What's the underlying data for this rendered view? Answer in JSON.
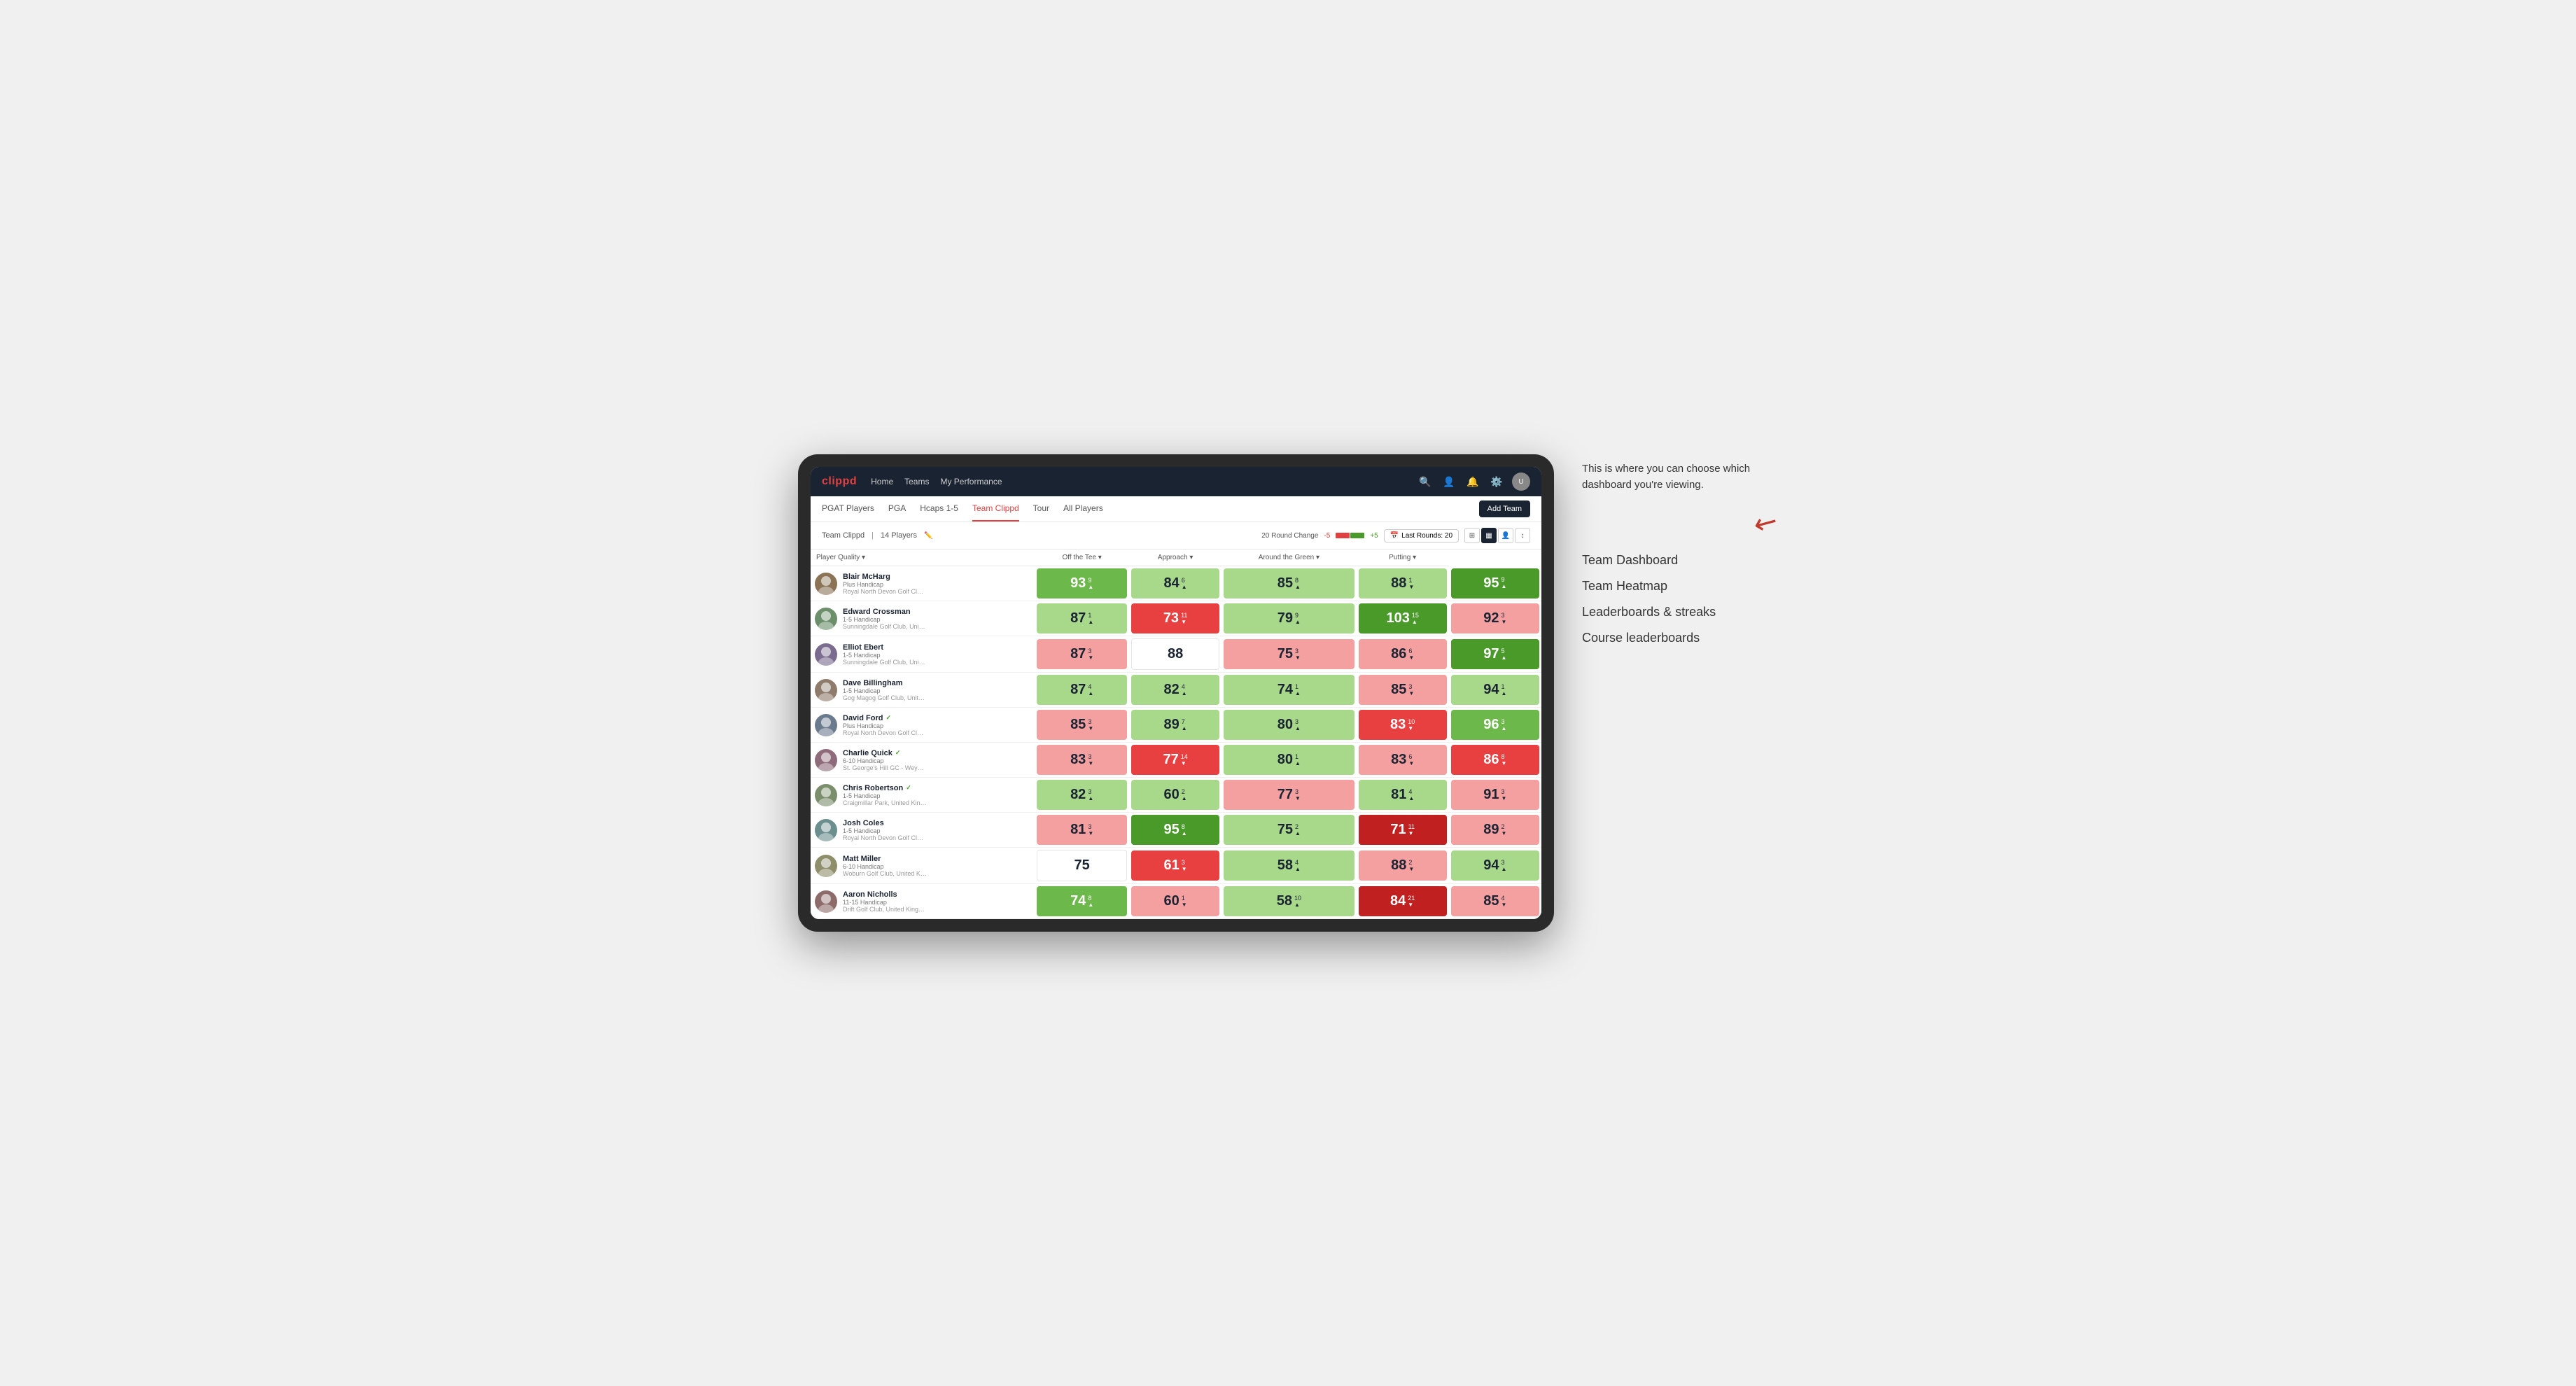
{
  "annotation": {
    "description": "This is where you can choose which dashboard you're viewing.",
    "options": [
      "Team Dashboard",
      "Team Heatmap",
      "Leaderboards & streaks",
      "Course leaderboards"
    ]
  },
  "nav": {
    "logo": "clippd",
    "items": [
      "Home",
      "Teams",
      "My Performance"
    ],
    "icons": [
      "search",
      "person",
      "bell",
      "settings",
      "avatar"
    ]
  },
  "sub_nav": {
    "items": [
      "PGAT Players",
      "PGA",
      "Hcaps 1-5",
      "Team Clippd",
      "Tour",
      "All Players"
    ],
    "active": "Team Clippd",
    "add_button": "Add Team"
  },
  "team_header": {
    "team_name": "Team Clippd",
    "player_count": "14 Players",
    "round_change_label": "20 Round Change",
    "change_neg": "-5",
    "change_pos": "+5",
    "last_rounds_label": "Last Rounds:",
    "last_rounds_value": "20"
  },
  "table": {
    "columns": [
      "Player Quality ▾",
      "Off the Tee ▾",
      "Approach ▾",
      "Around the Green ▾",
      "Putting ▾"
    ],
    "rows": [
      {
        "name": "Blair McHarg",
        "handicap": "Plus Handicap",
        "club": "Royal North Devon Golf Club, United Kingdom",
        "scores": [
          {
            "value": "93",
            "change": "9",
            "dir": "up",
            "color": "green-medium"
          },
          {
            "value": "84",
            "change": "6",
            "dir": "up",
            "color": "green-light"
          },
          {
            "value": "85",
            "change": "8",
            "dir": "up",
            "color": "green-light"
          },
          {
            "value": "88",
            "change": "1",
            "dir": "down",
            "color": "green-light"
          },
          {
            "value": "95",
            "change": "9",
            "dir": "up",
            "color": "green-dark"
          }
        ]
      },
      {
        "name": "Edward Crossman",
        "handicap": "1-5 Handicap",
        "club": "Sunningdale Golf Club, United Kingdom",
        "scores": [
          {
            "value": "87",
            "change": "1",
            "dir": "up",
            "color": "green-light"
          },
          {
            "value": "73",
            "change": "11",
            "dir": "down",
            "color": "red-medium"
          },
          {
            "value": "79",
            "change": "9",
            "dir": "up",
            "color": "green-light"
          },
          {
            "value": "103",
            "change": "15",
            "dir": "up",
            "color": "green-dark"
          },
          {
            "value": "92",
            "change": "3",
            "dir": "down",
            "color": "red-light"
          }
        ]
      },
      {
        "name": "Elliot Ebert",
        "handicap": "1-5 Handicap",
        "club": "Sunningdale Golf Club, United Kingdom",
        "scores": [
          {
            "value": "87",
            "change": "3",
            "dir": "down",
            "color": "red-light"
          },
          {
            "value": "88",
            "change": "",
            "dir": "",
            "color": "white-cell"
          },
          {
            "value": "75",
            "change": "3",
            "dir": "down",
            "color": "red-light"
          },
          {
            "value": "86",
            "change": "6",
            "dir": "down",
            "color": "red-light"
          },
          {
            "value": "97",
            "change": "5",
            "dir": "up",
            "color": "green-dark"
          }
        ]
      },
      {
        "name": "Dave Billingham",
        "handicap": "1-5 Handicap",
        "club": "Gog Magog Golf Club, United Kingdom",
        "scores": [
          {
            "value": "87",
            "change": "4",
            "dir": "up",
            "color": "green-light"
          },
          {
            "value": "82",
            "change": "4",
            "dir": "up",
            "color": "green-light"
          },
          {
            "value": "74",
            "change": "1",
            "dir": "up",
            "color": "green-light"
          },
          {
            "value": "85",
            "change": "3",
            "dir": "down",
            "color": "red-light"
          },
          {
            "value": "94",
            "change": "1",
            "dir": "up",
            "color": "green-light"
          }
        ]
      },
      {
        "name": "David Ford",
        "handicap": "Plus Handicap",
        "club": "Royal North Devon Golf Club, United Kingdom",
        "verified": true,
        "scores": [
          {
            "value": "85",
            "change": "3",
            "dir": "down",
            "color": "red-light"
          },
          {
            "value": "89",
            "change": "7",
            "dir": "up",
            "color": "green-light"
          },
          {
            "value": "80",
            "change": "3",
            "dir": "up",
            "color": "green-light"
          },
          {
            "value": "83",
            "change": "10",
            "dir": "down",
            "color": "red-medium"
          },
          {
            "value": "96",
            "change": "3",
            "dir": "up",
            "color": "green-medium"
          }
        ]
      },
      {
        "name": "Charlie Quick",
        "handicap": "6-10 Handicap",
        "club": "St. George's Hill GC - Weybridge - Surrey, Uni...",
        "verified": true,
        "scores": [
          {
            "value": "83",
            "change": "3",
            "dir": "down",
            "color": "red-light"
          },
          {
            "value": "77",
            "change": "14",
            "dir": "down",
            "color": "red-medium"
          },
          {
            "value": "80",
            "change": "1",
            "dir": "up",
            "color": "green-light"
          },
          {
            "value": "83",
            "change": "6",
            "dir": "down",
            "color": "red-light"
          },
          {
            "value": "86",
            "change": "8",
            "dir": "down",
            "color": "red-medium"
          }
        ]
      },
      {
        "name": "Chris Robertson",
        "handicap": "1-5 Handicap",
        "club": "Craigmillar Park, United Kingdom",
        "verified": true,
        "scores": [
          {
            "value": "82",
            "change": "3",
            "dir": "up",
            "color": "green-light"
          },
          {
            "value": "60",
            "change": "2",
            "dir": "up",
            "color": "green-light"
          },
          {
            "value": "77",
            "change": "3",
            "dir": "down",
            "color": "red-light"
          },
          {
            "value": "81",
            "change": "4",
            "dir": "up",
            "color": "green-light"
          },
          {
            "value": "91",
            "change": "3",
            "dir": "down",
            "color": "red-light"
          }
        ]
      },
      {
        "name": "Josh Coles",
        "handicap": "1-5 Handicap",
        "club": "Royal North Devon Golf Club, United Kingdom",
        "scores": [
          {
            "value": "81",
            "change": "3",
            "dir": "down",
            "color": "red-light"
          },
          {
            "value": "95",
            "change": "8",
            "dir": "up",
            "color": "green-dark"
          },
          {
            "value": "75",
            "change": "2",
            "dir": "up",
            "color": "green-light"
          },
          {
            "value": "71",
            "change": "11",
            "dir": "down",
            "color": "red-dark"
          },
          {
            "value": "89",
            "change": "2",
            "dir": "down",
            "color": "red-light"
          }
        ]
      },
      {
        "name": "Matt Miller",
        "handicap": "6-10 Handicap",
        "club": "Woburn Golf Club, United Kingdom",
        "scores": [
          {
            "value": "75",
            "change": "",
            "dir": "",
            "color": "white-cell"
          },
          {
            "value": "61",
            "change": "3",
            "dir": "down",
            "color": "red-medium"
          },
          {
            "value": "58",
            "change": "4",
            "dir": "up",
            "color": "green-light"
          },
          {
            "value": "88",
            "change": "2",
            "dir": "down",
            "color": "red-light"
          },
          {
            "value": "94",
            "change": "3",
            "dir": "up",
            "color": "green-light"
          }
        ]
      },
      {
        "name": "Aaron Nicholls",
        "handicap": "11-15 Handicap",
        "club": "Drift Golf Club, United Kingdom",
        "scores": [
          {
            "value": "74",
            "change": "8",
            "dir": "up",
            "color": "green-medium"
          },
          {
            "value": "60",
            "change": "1",
            "dir": "down",
            "color": "red-light"
          },
          {
            "value": "58",
            "change": "10",
            "dir": "up",
            "color": "green-light"
          },
          {
            "value": "84",
            "change": "21",
            "dir": "down",
            "color": "red-dark"
          },
          {
            "value": "85",
            "change": "4",
            "dir": "down",
            "color": "red-light"
          }
        ]
      }
    ]
  }
}
